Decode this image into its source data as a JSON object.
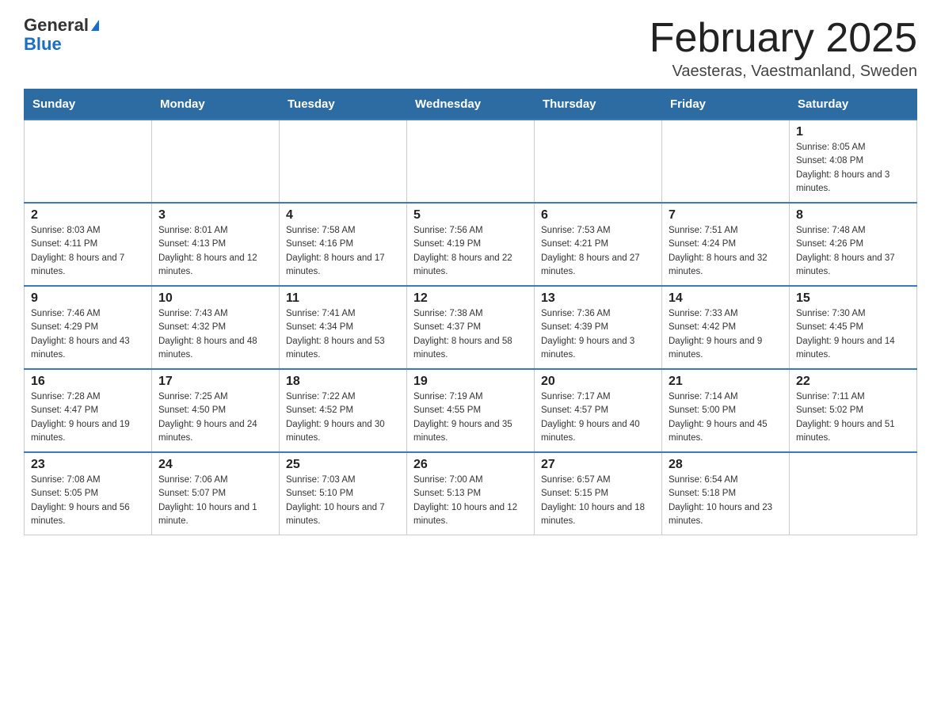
{
  "header": {
    "logo_general": "General",
    "logo_blue": "Blue",
    "month_title": "February 2025",
    "subtitle": "Vaesteras, Vaestmanland, Sweden"
  },
  "weekdays": [
    "Sunday",
    "Monday",
    "Tuesday",
    "Wednesday",
    "Thursday",
    "Friday",
    "Saturday"
  ],
  "weeks": [
    [
      {
        "day": "",
        "info": ""
      },
      {
        "day": "",
        "info": ""
      },
      {
        "day": "",
        "info": ""
      },
      {
        "day": "",
        "info": ""
      },
      {
        "day": "",
        "info": ""
      },
      {
        "day": "",
        "info": ""
      },
      {
        "day": "1",
        "info": "Sunrise: 8:05 AM\nSunset: 4:08 PM\nDaylight: 8 hours and 3 minutes."
      }
    ],
    [
      {
        "day": "2",
        "info": "Sunrise: 8:03 AM\nSunset: 4:11 PM\nDaylight: 8 hours and 7 minutes."
      },
      {
        "day": "3",
        "info": "Sunrise: 8:01 AM\nSunset: 4:13 PM\nDaylight: 8 hours and 12 minutes."
      },
      {
        "day": "4",
        "info": "Sunrise: 7:58 AM\nSunset: 4:16 PM\nDaylight: 8 hours and 17 minutes."
      },
      {
        "day": "5",
        "info": "Sunrise: 7:56 AM\nSunset: 4:19 PM\nDaylight: 8 hours and 22 minutes."
      },
      {
        "day": "6",
        "info": "Sunrise: 7:53 AM\nSunset: 4:21 PM\nDaylight: 8 hours and 27 minutes."
      },
      {
        "day": "7",
        "info": "Sunrise: 7:51 AM\nSunset: 4:24 PM\nDaylight: 8 hours and 32 minutes."
      },
      {
        "day": "8",
        "info": "Sunrise: 7:48 AM\nSunset: 4:26 PM\nDaylight: 8 hours and 37 minutes."
      }
    ],
    [
      {
        "day": "9",
        "info": "Sunrise: 7:46 AM\nSunset: 4:29 PM\nDaylight: 8 hours and 43 minutes."
      },
      {
        "day": "10",
        "info": "Sunrise: 7:43 AM\nSunset: 4:32 PM\nDaylight: 8 hours and 48 minutes."
      },
      {
        "day": "11",
        "info": "Sunrise: 7:41 AM\nSunset: 4:34 PM\nDaylight: 8 hours and 53 minutes."
      },
      {
        "day": "12",
        "info": "Sunrise: 7:38 AM\nSunset: 4:37 PM\nDaylight: 8 hours and 58 minutes."
      },
      {
        "day": "13",
        "info": "Sunrise: 7:36 AM\nSunset: 4:39 PM\nDaylight: 9 hours and 3 minutes."
      },
      {
        "day": "14",
        "info": "Sunrise: 7:33 AM\nSunset: 4:42 PM\nDaylight: 9 hours and 9 minutes."
      },
      {
        "day": "15",
        "info": "Sunrise: 7:30 AM\nSunset: 4:45 PM\nDaylight: 9 hours and 14 minutes."
      }
    ],
    [
      {
        "day": "16",
        "info": "Sunrise: 7:28 AM\nSunset: 4:47 PM\nDaylight: 9 hours and 19 minutes."
      },
      {
        "day": "17",
        "info": "Sunrise: 7:25 AM\nSunset: 4:50 PM\nDaylight: 9 hours and 24 minutes."
      },
      {
        "day": "18",
        "info": "Sunrise: 7:22 AM\nSunset: 4:52 PM\nDaylight: 9 hours and 30 minutes."
      },
      {
        "day": "19",
        "info": "Sunrise: 7:19 AM\nSunset: 4:55 PM\nDaylight: 9 hours and 35 minutes."
      },
      {
        "day": "20",
        "info": "Sunrise: 7:17 AM\nSunset: 4:57 PM\nDaylight: 9 hours and 40 minutes."
      },
      {
        "day": "21",
        "info": "Sunrise: 7:14 AM\nSunset: 5:00 PM\nDaylight: 9 hours and 45 minutes."
      },
      {
        "day": "22",
        "info": "Sunrise: 7:11 AM\nSunset: 5:02 PM\nDaylight: 9 hours and 51 minutes."
      }
    ],
    [
      {
        "day": "23",
        "info": "Sunrise: 7:08 AM\nSunset: 5:05 PM\nDaylight: 9 hours and 56 minutes."
      },
      {
        "day": "24",
        "info": "Sunrise: 7:06 AM\nSunset: 5:07 PM\nDaylight: 10 hours and 1 minute."
      },
      {
        "day": "25",
        "info": "Sunrise: 7:03 AM\nSunset: 5:10 PM\nDaylight: 10 hours and 7 minutes."
      },
      {
        "day": "26",
        "info": "Sunrise: 7:00 AM\nSunset: 5:13 PM\nDaylight: 10 hours and 12 minutes."
      },
      {
        "day": "27",
        "info": "Sunrise: 6:57 AM\nSunset: 5:15 PM\nDaylight: 10 hours and 18 minutes."
      },
      {
        "day": "28",
        "info": "Sunrise: 6:54 AM\nSunset: 5:18 PM\nDaylight: 10 hours and 23 minutes."
      },
      {
        "day": "",
        "info": ""
      }
    ]
  ]
}
